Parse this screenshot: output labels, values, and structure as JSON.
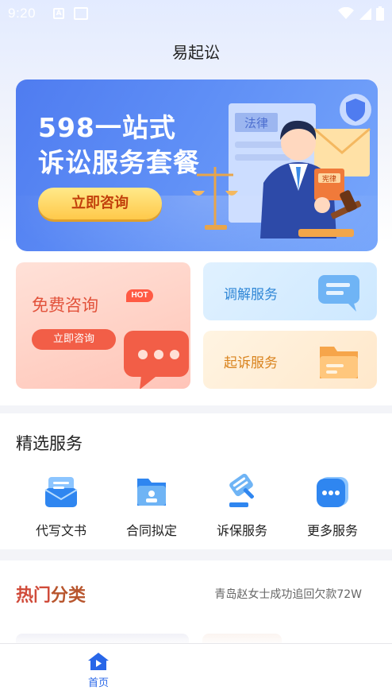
{
  "status_bar": {
    "time": "9:20",
    "icons": [
      "a-icon",
      "shop-icon",
      "wifi-icon",
      "signal-icon",
      "battery-icon"
    ]
  },
  "header": {
    "title": "易起讼"
  },
  "banner": {
    "line1": "598一站式",
    "line2": "诉讼服务套餐",
    "button_label": "立即咨询",
    "sign_text": "法律",
    "book_text": "宪律"
  },
  "cards": {
    "free": {
      "title": "免费咨询",
      "badge": "HOT",
      "button_label": "立即咨询"
    },
    "mediate": {
      "title": "调解服务"
    },
    "sue": {
      "title": "起诉服务"
    }
  },
  "featured": {
    "title": "精选服务",
    "items": [
      {
        "label": "代写文书",
        "icon": "document-icon"
      },
      {
        "label": "合同拟定",
        "icon": "contract-icon"
      },
      {
        "label": "诉保服务",
        "icon": "gavel-icon"
      },
      {
        "label": "更多服务",
        "icon": "more-icon"
      }
    ]
  },
  "hot": {
    "title_part1": "热门",
    "title_part2": "分类",
    "news": "青岛赵女士成功追回欠款72W"
  },
  "bottom_nav": {
    "home_label": "首页"
  },
  "colors": {
    "primary": "#2866e8",
    "banner_blue": "#5f8ff6",
    "free_red": "#f25e47",
    "mediate_blue": "#2f86d6",
    "sue_orange": "#d9831e"
  }
}
